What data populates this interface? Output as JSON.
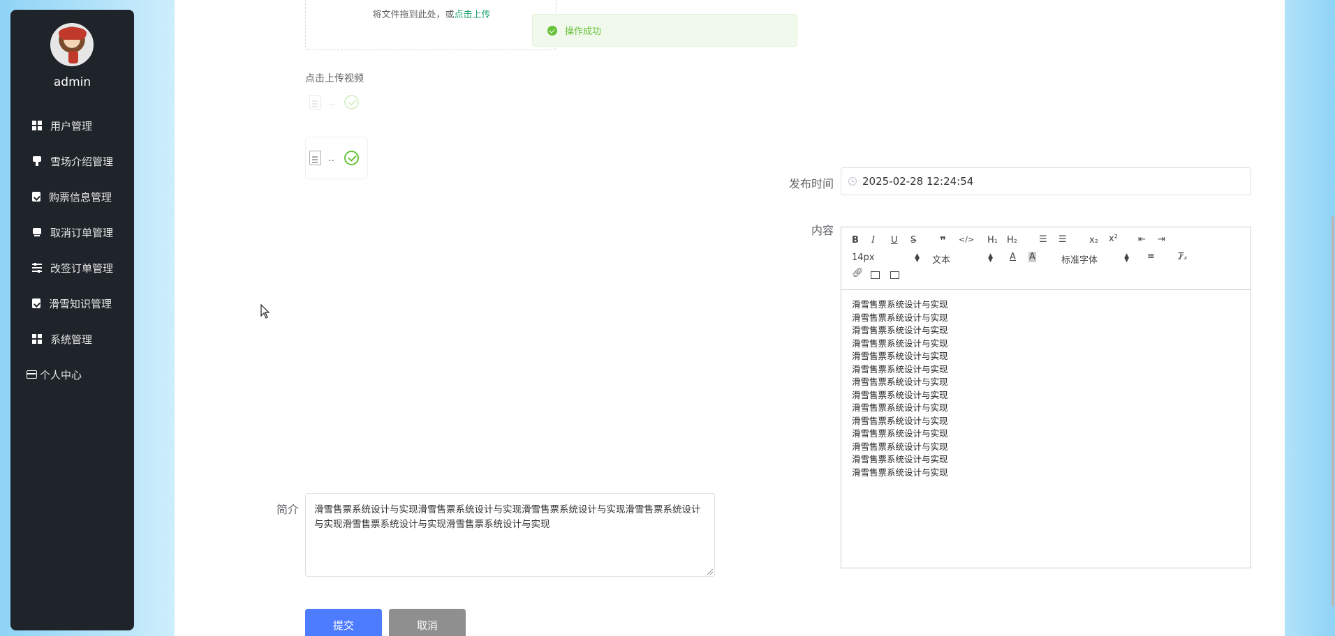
{
  "sidebar": {
    "username": "admin",
    "items": [
      {
        "label": "用户管理",
        "icon": "grid-icon"
      },
      {
        "label": "雪场介绍管理",
        "icon": "stamp-icon"
      },
      {
        "label": "购票信息管理",
        "icon": "clipboard-icon"
      },
      {
        "label": "取消订单管理",
        "icon": "ticket-icon"
      },
      {
        "label": "改签订单管理",
        "icon": "slider-icon"
      },
      {
        "label": "滑雪知识管理",
        "icon": "clipboard-icon"
      },
      {
        "label": "系统管理",
        "icon": "grid-icon"
      },
      {
        "label": "个人中心",
        "icon": "card-icon"
      }
    ]
  },
  "upload": {
    "hint_prefix": "将文件拖到此处，或",
    "hint_link": "点击上传",
    "video_label": "点击上传视频",
    "file_name": ".."
  },
  "toast": {
    "message": "操作成功"
  },
  "form": {
    "publish_label": "发布时间",
    "publish_value": "2025-02-28 12:24:54",
    "content_label": "内容",
    "intro_label": "简介",
    "intro_value": "滑雪售票系统设计与实现滑雪售票系统设计与实现滑雪售票系统设计与实现滑雪售票系统设计与实现滑雪售票系统设计与实现滑雪售票系统设计与实现"
  },
  "editor": {
    "size_select": "14px",
    "header_select": "文本",
    "font_select": "标准字体",
    "lines": [
      "滑雪售票系统设计与实现",
      "滑雪售票系统设计与实现",
      "滑雪售票系统设计与实现",
      "滑雪售票系统设计与实现",
      "滑雪售票系统设计与实现",
      "滑雪售票系统设计与实现",
      "滑雪售票系统设计与实现",
      "滑雪售票系统设计与实现",
      "滑雪售票系统设计与实现",
      "滑雪售票系统设计与实现",
      "滑雪售票系统设计与实现",
      "滑雪售票系统设计与实现",
      "滑雪售票系统设计与实现",
      "滑雪售票系统设计与实现"
    ]
  },
  "buttons": {
    "submit": "提交",
    "cancel": "取消"
  },
  "colors": {
    "sidebar_bg": "#1e2429",
    "submit": "#4e7cff",
    "cancel": "#8f8f8f",
    "success": "#67c23a",
    "link": "#1aa36a"
  }
}
